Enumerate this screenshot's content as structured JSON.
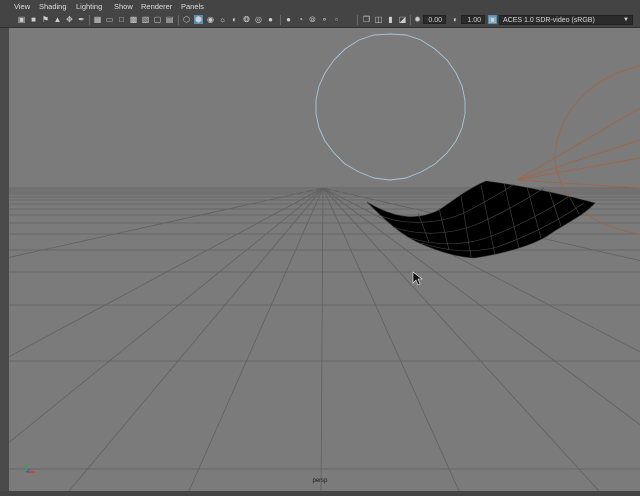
{
  "menubar": {
    "items": [
      "View",
      "Shading",
      "Lighting",
      "Show",
      "Renderer",
      "Panels"
    ]
  },
  "toolbar": {
    "exposure_value": "0.00",
    "gamma_value": "1.00",
    "color_space": "ACES 1.0 SDR-video (sRGB)",
    "icons": [
      "camera-attributes-icon",
      "bookmark-icon",
      "image-plane-icon",
      "grid-icon",
      "film-gate-icon",
      "resolution-gate-icon",
      "wireframe-icon",
      "smooth-shade-icon",
      "textured-icon",
      "lights-icon",
      "shadows-icon",
      "ambient-occlusion-icon",
      "motion-blur-icon",
      "anti-aliasing-icon",
      "isolate-select-icon",
      "xray-icon",
      "exposure-icon",
      "gamma-icon",
      "color-management-icon"
    ]
  },
  "viewport": {
    "camera_name": "persp",
    "background_color": "#7b7b7b",
    "grid_color": "#5f5f5f",
    "sphere_wire_color": "#a9c7d6",
    "camera_wire_color": "#a8623a"
  }
}
